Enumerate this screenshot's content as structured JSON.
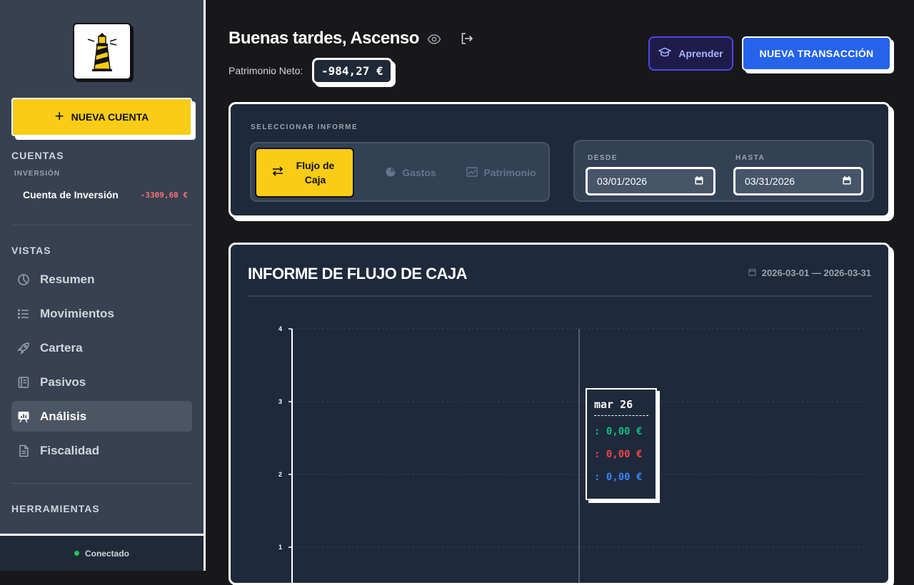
{
  "sidebar": {
    "new_account_label": "NUEVA CUENTA",
    "accounts_title": "CUENTAS",
    "investment_subtitle": "INVERSIÓN",
    "accounts": [
      {
        "name": "Cuenta de Inversión",
        "balance": "-3309,60 €"
      }
    ],
    "views_title": "VISTAS",
    "nav": [
      {
        "label": "Resumen",
        "icon": "pie-chart-icon"
      },
      {
        "label": "Movimientos",
        "icon": "list-icon"
      },
      {
        "label": "Cartera",
        "icon": "rocket-icon"
      },
      {
        "label": "Pasivos",
        "icon": "ledger-icon"
      },
      {
        "label": "Análisis",
        "icon": "presentation-chart-icon",
        "active": true
      },
      {
        "label": "Fiscalidad",
        "icon": "document-icon"
      }
    ],
    "tools_title": "HERRAMIENTAS",
    "status": "Conectado"
  },
  "header": {
    "greeting": "Buenas tardes, Ascenso",
    "networth_label": "Patrimonio Neto:",
    "networth_value": "-984,27 €",
    "learn_label": "Aprender",
    "new_tx_label": "NUEVA TRANSACCIÓN"
  },
  "report_selector": {
    "label": "SELECCIONAR INFORME",
    "options": [
      {
        "label": "Flujo de Caja",
        "active": true
      },
      {
        "label": "Gastos"
      },
      {
        "label": "Patrimonio"
      }
    ],
    "from_label": "DESDE",
    "from_value": "03/01/2026",
    "to_label": "HASTA",
    "to_value": "03/31/2026"
  },
  "report": {
    "title": "INFORME DE FLUJO DE CAJA",
    "range": "2026-03-01 — 2026-03-31"
  },
  "chart_data": {
    "type": "line",
    "yticks": [
      "4",
      "3",
      "2",
      "1"
    ],
    "ylim": [
      0,
      4
    ],
    "grid": true,
    "tooltip": {
      "date": "mar 26",
      "rows": [
        {
          "value": ": 0,00 €",
          "color": "#10b981"
        },
        {
          "value": ": 0,00 €",
          "color": "#ef4444"
        },
        {
          "value": ": 0,00 €",
          "color": "#3b82f6"
        }
      ]
    }
  },
  "colors": {
    "accent_yellow": "#facc15",
    "accent_blue": "#2563eb",
    "negative": "#f87171"
  }
}
